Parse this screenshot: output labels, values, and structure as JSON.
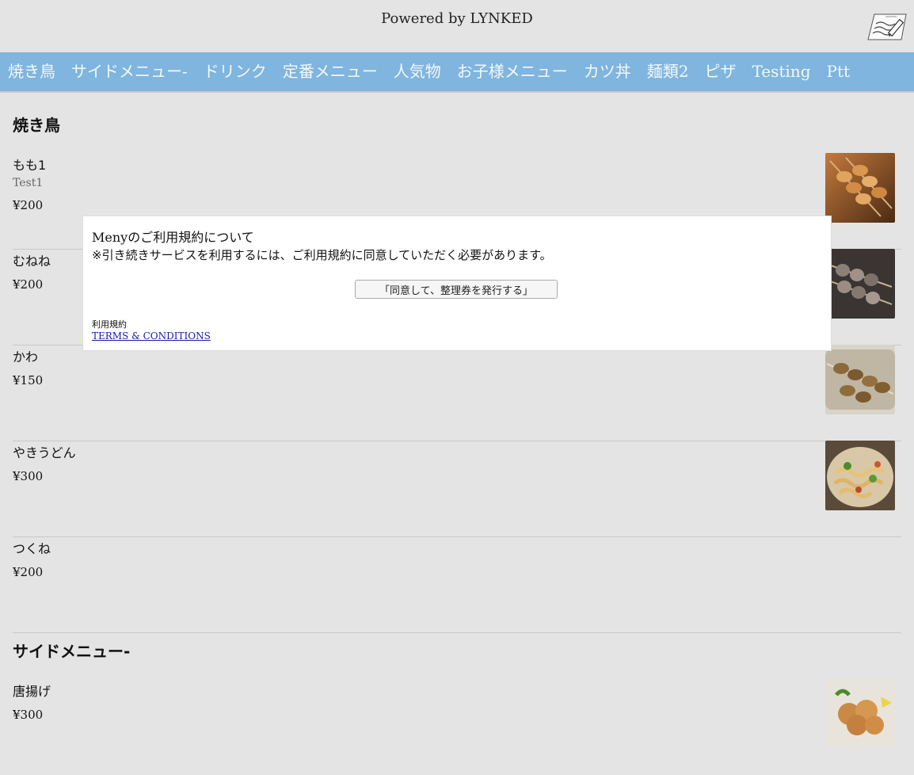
{
  "header": {
    "powered_by": "Powered by LYNKED",
    "icon": "memo-pen-icon"
  },
  "nav": {
    "tabs": [
      "焼き鳥",
      "サイドメニュー-",
      "ドリンク",
      "定番メニュー",
      "人気物",
      "お子様メニュー",
      "カツ丼",
      "麺類2",
      "ピザ",
      "Testing",
      "Ptt"
    ]
  },
  "sections": [
    {
      "title": "焼き鳥",
      "items": [
        {
          "name": "もも1",
          "desc": "Test1",
          "price": "¥200",
          "image": "yakitori-momo-photo"
        },
        {
          "name": "むねね",
          "price": "¥200",
          "image": "yakitori-mune-photo"
        },
        {
          "name": "かわ",
          "price": "¥150",
          "image": "yakitori-kawa-photo"
        },
        {
          "name": "やきうどん",
          "price": "¥300",
          "image": "yaki-udon-photo"
        },
        {
          "name": "つくね",
          "price": "¥200"
        }
      ]
    },
    {
      "title": "サイドメニュー-",
      "items": [
        {
          "name": "唐揚げ",
          "price": "¥300",
          "image": "karaage-photo"
        }
      ]
    }
  ],
  "modal": {
    "title": "Menyのご利用規約について",
    "note": "※引き続きサービスを利用するには、ご利用規約に同意していただく必要があります。",
    "agree_button": "「同意して、整理券を発行する」",
    "terms_label": "利用規約",
    "terms_link": "TERMS & CONDITIONS"
  },
  "colors": {
    "nav_bg": "#7fb5de",
    "page_bg": "#e4e4e4",
    "link": "#1a1aa8"
  }
}
